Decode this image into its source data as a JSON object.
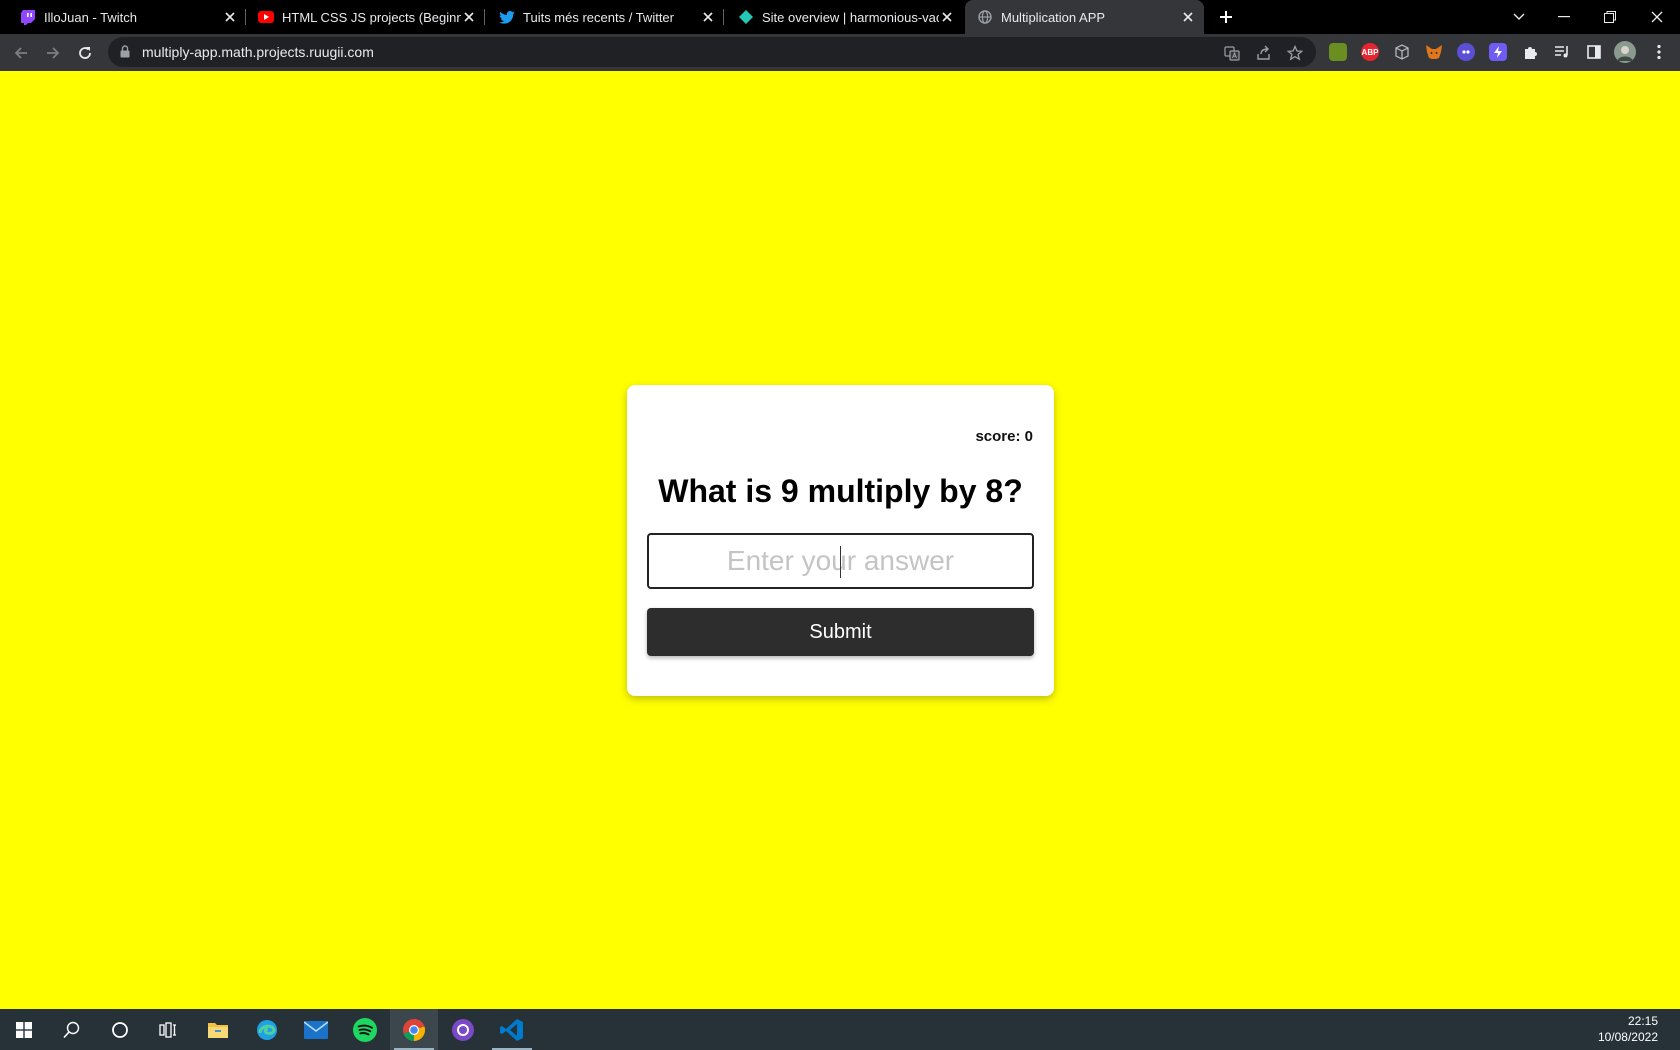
{
  "browser": {
    "tabs": [
      {
        "title": "IlloJuan - Twitch",
        "icon": "twitch-icon"
      },
      {
        "title": "HTML CSS JS projects (Beginner)",
        "icon": "youtube-icon"
      },
      {
        "title": "Tuits més recents / Twitter",
        "icon": "twitter-icon"
      },
      {
        "title": "Site overview | harmonious-vache",
        "icon": "netlify-icon"
      },
      {
        "title": "Multiplication APP",
        "icon": "globe-icon",
        "active": true
      }
    ],
    "url": "multiply-app.math.projects.ruugii.com",
    "extensions": [
      "ABP"
    ]
  },
  "app": {
    "background": "#ffff00",
    "score_text": "score: 0",
    "question": "What is 9 multiply by 8?",
    "answer_placeholder": "Enter your answer",
    "answer_value": "",
    "submit_label": "Submit"
  },
  "taskbar": {
    "apps": [
      "windows-start-icon",
      "search-icon",
      "cortana-icon",
      "task-view-icon",
      "file-explorer-icon",
      "edge-icon",
      "mail-icon",
      "spotify-icon",
      "chrome-icon",
      "github-desktop-icon",
      "vscode-icon"
    ],
    "active_app": "chrome-icon",
    "time": "22:15",
    "date": "10/08/2022"
  },
  "colors": {
    "tabstrip": "#000000",
    "toolbar": "#35363a",
    "omnibox": "#202124",
    "page_background": "#ffff00",
    "card": "#ffffff",
    "submit_button": "#2d2d2d",
    "taskbar": "#273238"
  }
}
